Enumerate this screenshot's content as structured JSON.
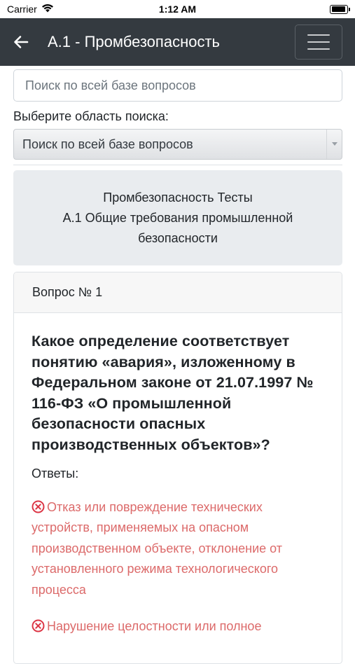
{
  "status_bar": {
    "carrier": "Carrier",
    "time": "1:12 AM",
    "battery_level": 0.95
  },
  "navbar": {
    "title": "А.1 - Промбезопасность",
    "back_icon": "arrow-left-icon",
    "menu_icon": "hamburger-icon"
  },
  "search": {
    "placeholder": "Поиск по всей базе вопросов"
  },
  "area": {
    "label": "Выберите область поиска:",
    "selected": "Поиск по всей базе вопросов"
  },
  "section": {
    "line1": "Промбезопасность Тесты",
    "line2": "А.1 Общие требования промышленной безопасности"
  },
  "question": {
    "number_label": "Вопрос № 1",
    "text": "Какое определение соответствует понятию «авария», изложенному в Федеральном законе от 21.07.1997 № 116-ФЗ «О промышленной безопасности опасных производственных объектов»?",
    "answers_label": "Ответы:",
    "answers": [
      {
        "text": "Отказ или повреждение технических устройств, применяемых на опасном производственном объекте, отклонение от установленного режима технологического процесса",
        "status": "wrong"
      },
      {
        "text": "Нарушение целостности или полное",
        "status": "wrong"
      }
    ]
  },
  "colors": {
    "navbar_bg": "#343a40",
    "wrong_answer": "#dc6a6a",
    "card_bg": "#e9ecef"
  }
}
